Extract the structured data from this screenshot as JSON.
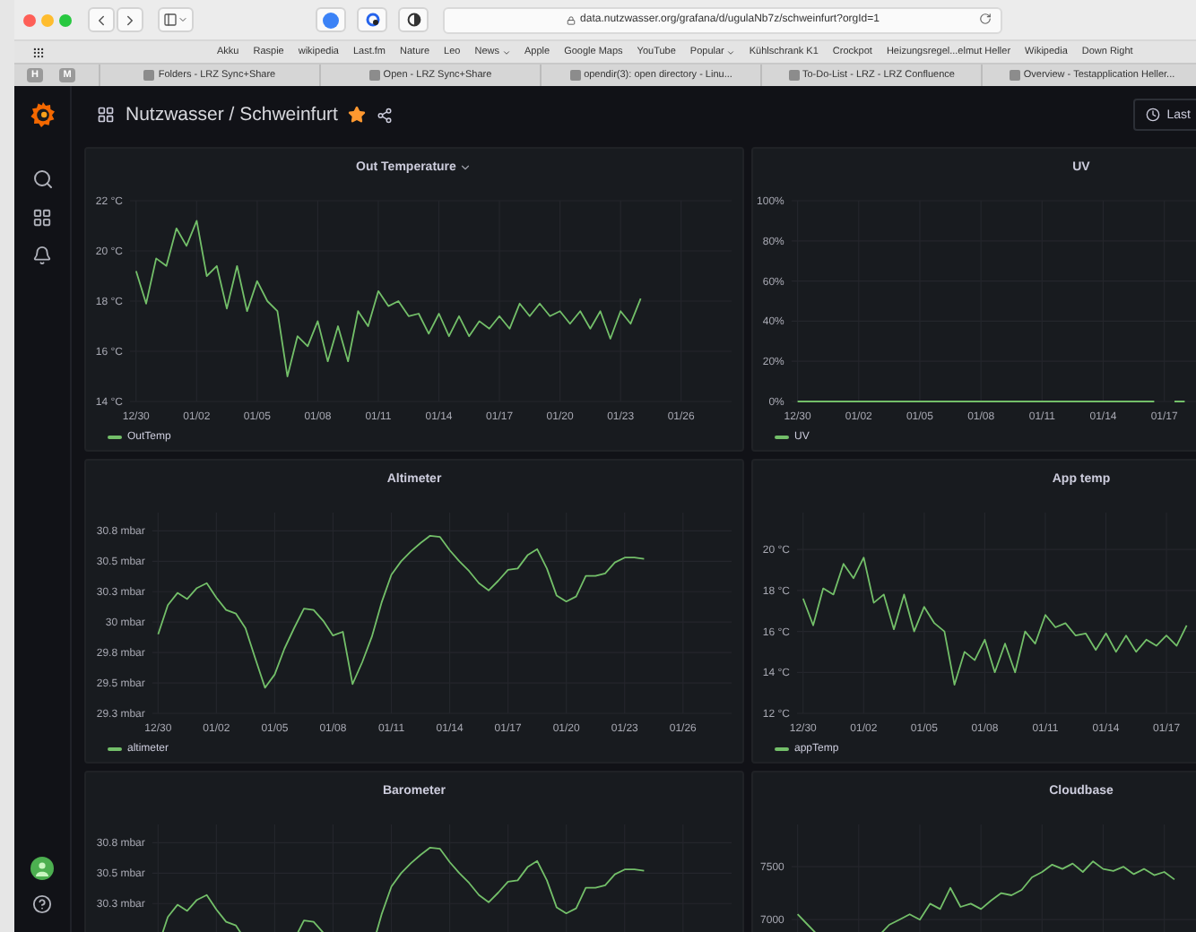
{
  "browser": {
    "url": "data.nutzwasser.org/grafana/d/ugulaNb7z/schweinfurt?orgId=1",
    "bookmarks": [
      {
        "label": "Akku",
        "menu": false
      },
      {
        "label": "Raspie",
        "menu": false
      },
      {
        "label": "wikipedia",
        "menu": false
      },
      {
        "label": "Last.fm",
        "menu": false
      },
      {
        "label": "Nature",
        "menu": false
      },
      {
        "label": "Leo",
        "menu": false
      },
      {
        "label": "News",
        "menu": true
      },
      {
        "label": "Apple",
        "menu": false
      },
      {
        "label": "Google Maps",
        "menu": false
      },
      {
        "label": "YouTube",
        "menu": false
      },
      {
        "label": "Popular",
        "menu": true
      },
      {
        "label": "Kühlschrank K1",
        "menu": false
      },
      {
        "label": "Crockpot",
        "menu": false
      },
      {
        "label": "Heizungsregel...elmut Heller",
        "menu": false
      },
      {
        "label": "Wikipedia",
        "menu": false
      },
      {
        "label": "Down Right",
        "menu": false
      }
    ],
    "pinned_tabs": [
      "H",
      "M"
    ],
    "tabs": [
      {
        "title": "Folders - LRZ Sync+Share"
      },
      {
        "title": "Open - LRZ Sync+Share"
      },
      {
        "title": "opendir(3): open directory - Linu..."
      },
      {
        "title": "To-Do-List - LRZ - LRZ Confluence"
      },
      {
        "title": "Overview - Testapplication Heller..."
      }
    ]
  },
  "dashboard": {
    "title": "Nutzwasser / Schweinfurt",
    "starred": true,
    "time_picker": "Last"
  },
  "panels": [
    {
      "kind": "chart",
      "show_menu_caret": true,
      "chart_data": {
        "type": "line",
        "title": "Out Temperature",
        "grid": true,
        "ylim": [
          14,
          22
        ],
        "categories": [
          "12/30",
          null,
          null,
          null,
          null,
          null,
          "01/02",
          null,
          null,
          null,
          null,
          null,
          "01/05",
          null,
          null,
          null,
          null,
          null,
          "01/08",
          null,
          null,
          null,
          null,
          null,
          "01/11",
          null,
          null,
          null,
          null,
          null,
          "01/14",
          null,
          null,
          null,
          null,
          null,
          "01/17",
          null,
          null,
          null,
          null,
          null,
          "01/20",
          null,
          null,
          null,
          null,
          null,
          "01/23",
          null,
          null,
          null,
          null,
          null,
          "01/26"
        ],
        "series": [
          {
            "name": "OutTemp",
            "color": "#73bf69",
            "values": [
              19.2,
              17.9,
              19.7,
              19.4,
              20.9,
              20.2,
              21.2,
              19.0,
              19.4,
              17.7,
              19.4,
              17.6,
              18.8,
              18.0,
              17.6,
              15.0,
              16.6,
              16.2,
              17.2,
              15.6,
              17.0,
              15.6,
              17.6,
              17.0,
              18.4,
              17.8,
              18.0,
              17.4,
              17.5,
              16.7,
              17.5,
              16.6,
              17.4,
              16.6,
              17.2,
              16.9,
              17.4,
              16.9,
              17.9,
              17.4,
              17.9,
              17.4,
              17.6,
              17.1,
              17.6,
              16.9,
              17.6,
              16.5,
              17.6,
              17.1,
              18.1,
              null,
              null,
              null,
              null
            ]
          }
        ],
        "yticks": [
          {
            "value": 14,
            "label": "14 °C"
          },
          {
            "value": 16,
            "label": "16 °C"
          },
          {
            "value": 18,
            "label": "18 °C"
          },
          {
            "value": 20,
            "label": "20 °C"
          },
          {
            "value": 22,
            "label": "22 °C"
          }
        ]
      }
    },
    {
      "kind": "chart",
      "chart_data": {
        "type": "line",
        "title": "UV",
        "grid": true,
        "ylim": [
          0,
          100
        ],
        "categories": [
          "12/30",
          null,
          null,
          null,
          null,
          null,
          "01/02",
          null,
          null,
          null,
          null,
          null,
          "01/05",
          null,
          null,
          null,
          null,
          null,
          "01/08",
          null,
          null,
          null,
          null,
          null,
          "01/11",
          null,
          null,
          null,
          null,
          null,
          "01/14",
          null,
          null,
          null,
          null,
          null,
          "01/17",
          null,
          null
        ],
        "series": [
          {
            "name": "UV",
            "color": "#73bf69",
            "values": [
              0,
              0,
              0,
              0,
              0,
              0,
              0,
              0,
              0,
              0,
              0,
              0,
              0,
              0,
              0,
              0,
              0,
              0,
              0,
              0,
              0,
              0,
              0,
              0,
              0,
              0,
              0,
              0,
              0,
              0,
              0,
              0,
              0,
              0,
              0,
              0,
              null,
              0,
              0
            ]
          }
        ],
        "yticks": [
          {
            "value": 0,
            "label": "0%"
          },
          {
            "value": 20,
            "label": "20%"
          },
          {
            "value": 40,
            "label": "40%"
          },
          {
            "value": 60,
            "label": "60%"
          },
          {
            "value": 80,
            "label": "80%"
          },
          {
            "value": 100,
            "label": "100%"
          }
        ]
      }
    },
    {
      "kind": "chart",
      "chart_data": {
        "type": "line",
        "title": "Altimeter",
        "grid": true,
        "ylim": [
          29.25,
          30.9
        ],
        "categories": [
          "12/30",
          null,
          null,
          null,
          null,
          null,
          "01/02",
          null,
          null,
          null,
          null,
          null,
          "01/05",
          null,
          null,
          null,
          null,
          null,
          "01/08",
          null,
          null,
          null,
          null,
          null,
          "01/11",
          null,
          null,
          null,
          null,
          null,
          "01/14",
          null,
          null,
          null,
          null,
          null,
          "01/17",
          null,
          null,
          null,
          null,
          null,
          "01/20",
          null,
          null,
          null,
          null,
          null,
          "01/23",
          null,
          null,
          null,
          null,
          null,
          "01/26"
        ],
        "series": [
          {
            "name": "altimeter",
            "color": "#73bf69",
            "values": [
              29.9,
              30.14,
              30.24,
              30.19,
              30.28,
              30.32,
              30.2,
              30.1,
              30.07,
              29.95,
              29.7,
              29.46,
              29.57,
              29.78,
              29.95,
              30.11,
              30.1,
              30.01,
              29.89,
              29.92,
              29.49,
              29.67,
              29.88,
              30.16,
              30.39,
              30.5,
              30.58,
              30.65,
              30.71,
              30.7,
              30.59,
              30.5,
              30.42,
              30.32,
              30.26,
              30.34,
              30.43,
              30.44,
              30.55,
              30.6,
              30.44,
              30.22,
              30.17,
              30.21,
              30.38,
              30.38,
              30.4,
              30.49,
              30.53,
              30.53,
              30.52,
              null,
              null,
              null,
              null
            ]
          }
        ],
        "yticks": [
          {
            "value": 29.25,
            "label": "29.3 mbar"
          },
          {
            "value": 29.5,
            "label": "29.5 mbar"
          },
          {
            "value": 29.75,
            "label": "29.8 mbar"
          },
          {
            "value": 30,
            "label": "30 mbar"
          },
          {
            "value": 30.25,
            "label": "30.3 mbar"
          },
          {
            "value": 30.5,
            "label": "30.5 mbar"
          },
          {
            "value": 30.75,
            "label": "30.8 mbar"
          }
        ]
      }
    },
    {
      "kind": "chart",
      "chart_data": {
        "type": "line",
        "title": "App temp",
        "grid": true,
        "ylim": [
          12,
          21.8
        ],
        "categories": [
          "12/30",
          null,
          null,
          null,
          null,
          null,
          "01/02",
          null,
          null,
          null,
          null,
          null,
          "01/05",
          null,
          null,
          null,
          null,
          null,
          "01/08",
          null,
          null,
          null,
          null,
          null,
          "01/11",
          null,
          null,
          null,
          null,
          null,
          "01/14",
          null,
          null,
          null,
          null,
          null,
          "01/17",
          null,
          null
        ],
        "series": [
          {
            "name": "appTemp",
            "color": "#73bf69",
            "values": [
              17.6,
              16.3,
              18.1,
              17.8,
              19.3,
              18.6,
              19.6,
              17.4,
              17.8,
              16.1,
              17.8,
              16.0,
              17.2,
              16.4,
              16.0,
              13.4,
              15.0,
              14.6,
              15.6,
              14.0,
              15.4,
              14.0,
              16.0,
              15.4,
              16.8,
              16.2,
              16.4,
              15.8,
              15.9,
              15.1,
              15.9,
              15.0,
              15.8,
              15.0,
              15.6,
              15.3,
              15.8,
              15.3,
              16.3
            ]
          }
        ],
        "yticks": [
          {
            "value": 12,
            "label": "12 °C"
          },
          {
            "value": 14,
            "label": "14 °C"
          },
          {
            "value": 16,
            "label": "16 °C"
          },
          {
            "value": 18,
            "label": "18 °C"
          },
          {
            "value": 20,
            "label": "20 °C"
          }
        ]
      }
    },
    {
      "kind": "sparkline",
      "title": "Barometer",
      "axis_labels": [
        "30.8 mbar",
        "30.5 mbar",
        "30.3 mbar"
      ]
    },
    {
      "kind": "sparkline",
      "title": "Cloudbase",
      "axis_labels": [
        "7500",
        "7000"
      ]
    }
  ]
}
